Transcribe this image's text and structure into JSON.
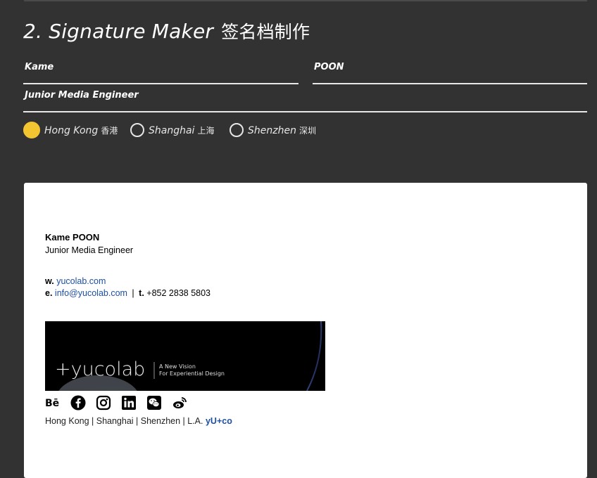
{
  "section": {
    "title": "2. Signature Maker",
    "title_cjk": "签名档制作"
  },
  "form": {
    "first_name": "Kame",
    "last_name": "POON",
    "job_title": "Junior Media Engineer",
    "locations": [
      {
        "label": "Hong Kong",
        "label_cjk": "香港",
        "selected": true
      },
      {
        "label": "Shanghai",
        "label_cjk": "上海",
        "selected": false
      },
      {
        "label": "Shenzhen",
        "label_cjk": "深圳",
        "selected": false
      }
    ]
  },
  "signature": {
    "name": "Kame POON",
    "role": "Junior Media Engineer",
    "web_label": "w.",
    "web": "yucolab.com",
    "email_label": "e.",
    "email": "info@yucolab.com",
    "separator": "|",
    "phone_label": "t.",
    "phone": "+852 2838 5803",
    "banner": {
      "logo": "+yucolab",
      "tagline_1": "A New Vision",
      "tagline_2": "For Experiential Design"
    },
    "social_icons": [
      "behance-icon",
      "facebook-icon",
      "instagram-icon",
      "linkedin-icon",
      "wechat-icon",
      "weibo-icon"
    ],
    "offices": "Hong Kong | Shanghai | Shenzhen | L.A.",
    "brand_mark": "yU+co"
  },
  "colors": {
    "background": "#333232",
    "accent_radio": "#f3c531",
    "link": "#1e4fa3"
  }
}
